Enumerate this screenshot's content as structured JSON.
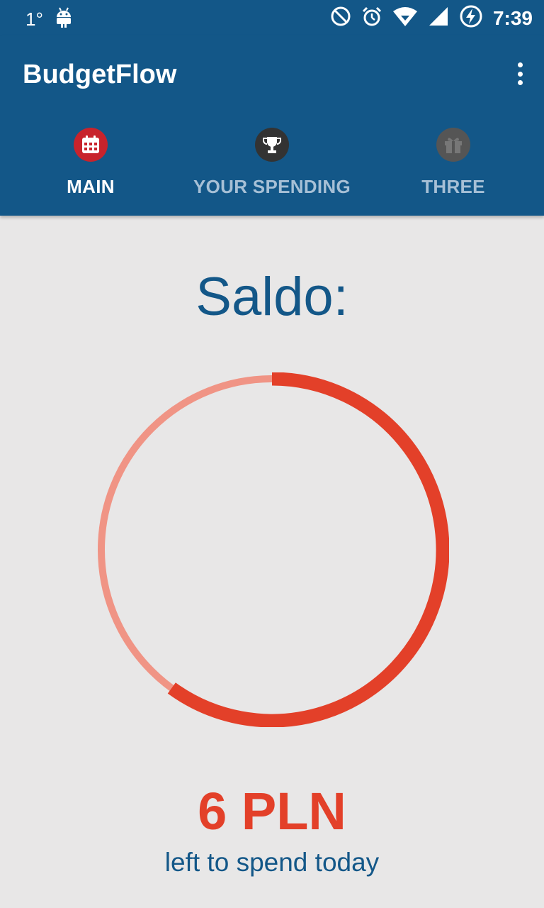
{
  "status_bar": {
    "temperature": "1°",
    "time": "7:39",
    "icons": [
      "android-debug-icon",
      "do-not-disturb-icon",
      "alarm-icon",
      "wifi-icon",
      "cell-signal-icon",
      "battery-charging-icon"
    ]
  },
  "app_bar": {
    "title": "BudgetFlow",
    "menu_icon": "more-vert-icon"
  },
  "tabs": [
    {
      "label": "MAIN",
      "icon": "calendar-icon",
      "active": true,
      "icon_color": "#c8232c"
    },
    {
      "label": "YOUR SPENDING",
      "icon": "trophy-icon",
      "active": false,
      "icon_color": "#333333"
    },
    {
      "label": "THREE",
      "icon": "gift-icon",
      "active": false,
      "icon_color": "#555555"
    }
  ],
  "main": {
    "heading": "Saldo:",
    "progress_remaining_fraction": 0.6,
    "amount": "6 PLN",
    "caption": "left to spend today"
  },
  "colors": {
    "primary": "#135788",
    "accent": "#e34029",
    "track": "#f09485",
    "background": "#e8e7e7"
  }
}
